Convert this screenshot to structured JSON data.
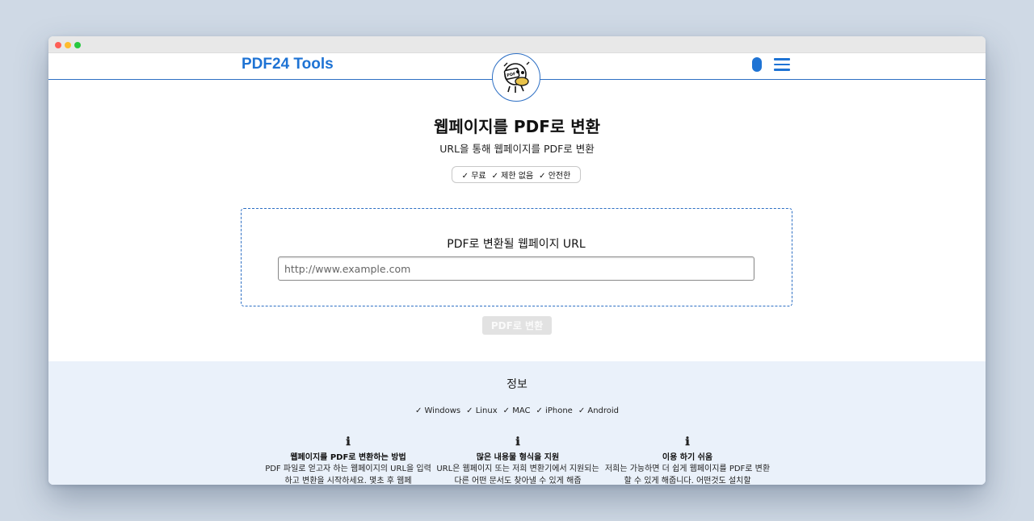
{
  "header": {
    "brand": "PDF24 Tools",
    "colors": {
      "accent": "#1e73d4",
      "divider": "#2d6fc4"
    }
  },
  "hero": {
    "title": "웹페이지를 PDF로 변환",
    "subtitle": "URL을 통해 웹페이지를 PDF로 변환",
    "features": [
      "✓ 무료",
      "✓ 제한 없음",
      "✓ 안전한"
    ]
  },
  "converter": {
    "label": "PDF로 변환될 웹페이지 URL",
    "input_value": "",
    "input_placeholder": "http://www.example.com",
    "button_label": "PDF로 변환"
  },
  "info": {
    "title": "정보",
    "platforms": [
      "✓ Windows",
      "✓ Linux",
      "✓ MAC",
      "✓ iPhone",
      "✓ Android"
    ],
    "columns": [
      {
        "icon": "info-icon",
        "heading": "웹페이지를 PDF로 변환하는 방법",
        "body": "PDF 파일로 얻고자 하는 웹페이지의 URL을 입력하고 변환을 시작하세요. 몇초 후 웹페"
      },
      {
        "icon": "info-icon",
        "heading": "많은 내용물 형식을 지원",
        "body": "URL은 웹페이지 또는 저희 변환기에서 지원되는 다른 어떤 문서도 찾아낼 수 있게 해줍"
      },
      {
        "icon": "info-icon",
        "heading": "이용 하기 쉬움",
        "body": "저희는 가능하면 더 쉽게 웹페이지를 PDF로 변환할 수 있게 해줍니다. 어떤것도 설치할"
      }
    ]
  }
}
